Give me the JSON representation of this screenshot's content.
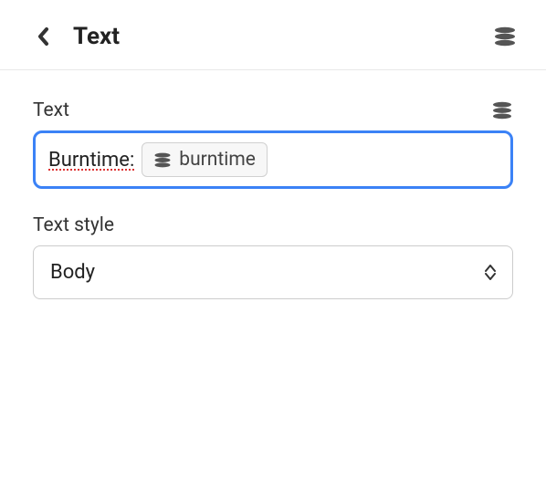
{
  "header": {
    "title": "Text"
  },
  "text_field": {
    "label": "Text",
    "inline_value": "Burntime: ",
    "chip_label": "burntime"
  },
  "style_field": {
    "label": "Text style",
    "selected": "Body"
  }
}
